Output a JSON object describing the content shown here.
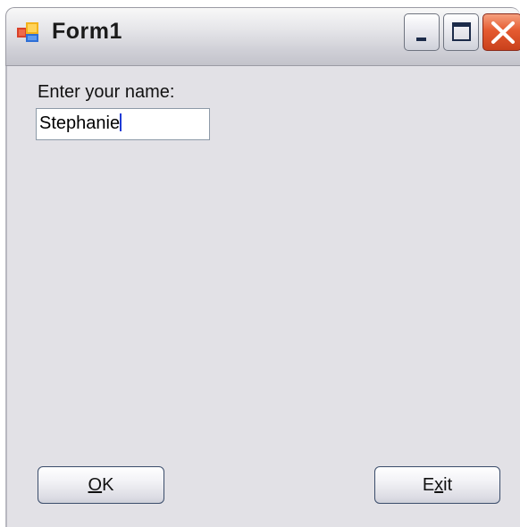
{
  "window": {
    "title": "Form1",
    "icon": "winforms-app-icon",
    "controls": {
      "minimize": "minimize-icon",
      "maximize": "maximize-icon",
      "close": "close-icon"
    }
  },
  "form": {
    "name_label": "Enter your name:",
    "name_value": "Stephanie"
  },
  "buttons": {
    "ok": {
      "mnemonic": "O",
      "rest": "K"
    },
    "exit": {
      "before": "E",
      "mnemonic": "x",
      "after": "it"
    }
  },
  "colors": {
    "client_background": "#e2e1e6",
    "close_button": "#e55a30",
    "caret": "#1f3bd6"
  }
}
